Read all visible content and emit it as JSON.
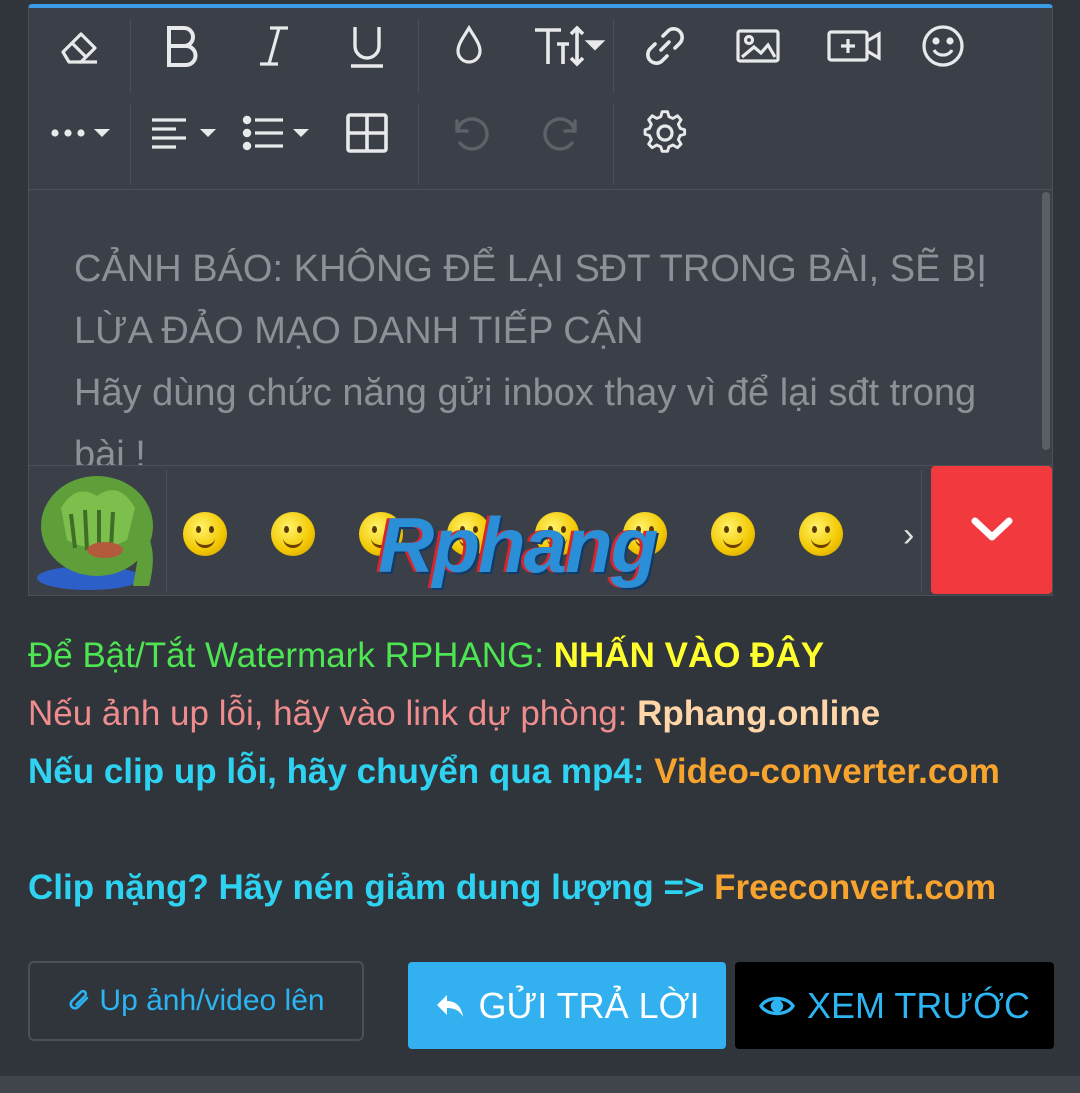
{
  "toolbar": {
    "row1": [
      {
        "icon": "eraser-icon",
        "label": "Remove formatting"
      },
      {
        "icon": "bold-icon",
        "label": "B"
      },
      {
        "icon": "italic-icon",
        "label": "I"
      },
      {
        "icon": "underline-icon",
        "label": "U"
      },
      {
        "icon": "text-color-icon",
        "label": "Text color"
      },
      {
        "icon": "font-size-icon",
        "label": "TT"
      },
      {
        "icon": "link-icon",
        "label": "Link"
      },
      {
        "icon": "image-icon",
        "label": "Image"
      },
      {
        "icon": "media-icon",
        "label": "Media"
      },
      {
        "icon": "smiley-icon",
        "label": "Smilies"
      }
    ],
    "row2": [
      {
        "icon": "more-options-icon",
        "label": "More"
      },
      {
        "icon": "align-icon",
        "label": "Align"
      },
      {
        "icon": "list-icon",
        "label": "List"
      },
      {
        "icon": "table-icon",
        "label": "Table"
      },
      {
        "icon": "undo-icon",
        "label": "Undo"
      },
      {
        "icon": "redo-icon",
        "label": "Redo"
      },
      {
        "icon": "settings-icon",
        "label": "Settings"
      }
    ]
  },
  "editor": {
    "placeholder_line1": "CẢNH BÁO: KHÔNG ĐỂ LẠI SĐT TRONG BÀI, SẼ BỊ LỪA ĐẢO MẠO DANH TIẾP CẬN",
    "placeholder_line2": "Hãy dùng chức năng gửi inbox thay vì để lại sđt trong bài !"
  },
  "emoji_bar": {
    "watermark": "Rphang",
    "emojis": [
      "pepe-facepalm",
      "smile",
      "wink",
      "grin",
      "laugh",
      "giggle",
      "shocked",
      "scream",
      "cool"
    ],
    "next_icon": "chevron-right-icon",
    "collapse_icon": "chevron-down-icon"
  },
  "notices": {
    "watermark_text": "Để Bật/Tắt Watermark RPHANG: ",
    "watermark_link": "NHẤN VÀO ĐÂY",
    "backup_text": "Nếu ảnh up lỗi, hãy vào link dự phòng: ",
    "backup_link": "Rphang.online",
    "clip_text": "Nếu clip up lỗi, hãy chuyển qua mp4: ",
    "clip_link": "Video-converter.com",
    "compress_text": "Clip nặng? Hãy nén giảm dung lượng => ",
    "compress_link": "Freeconvert.com"
  },
  "actions": {
    "upload_label": "Up ảnh/video lên",
    "reply_label": "GỬI TRẢ LỜI",
    "preview_label": "XEM TRƯỚC"
  },
  "colors": {
    "accent": "#3b9be6",
    "reply_button": "#33b0f0",
    "collapse_button": "#f2393e",
    "background": "#30343b"
  }
}
